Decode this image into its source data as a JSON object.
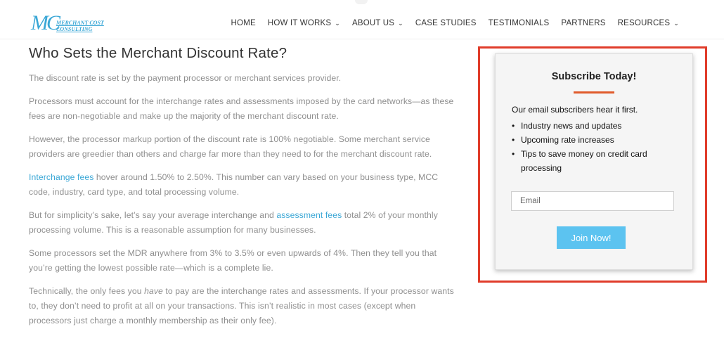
{
  "header": {
    "logo": {
      "mark": "MC",
      "text_line1": "MERCHANT COST",
      "text_line2": "CONSULTING"
    },
    "nav": [
      {
        "label": "HOME",
        "dropdown": false
      },
      {
        "label": "HOW IT WORKS",
        "dropdown": true
      },
      {
        "label": "ABOUT US",
        "dropdown": true
      },
      {
        "label": "CASE STUDIES",
        "dropdown": false
      },
      {
        "label": "TESTIMONIALS",
        "dropdown": false
      },
      {
        "label": "PARTNERS",
        "dropdown": false
      },
      {
        "label": "RESOURCES",
        "dropdown": true
      }
    ]
  },
  "article": {
    "title": "Who Sets the Merchant Discount Rate?",
    "p1": "The discount rate is set by the payment processor or merchant services provider.",
    "p2": "Processors must account for the interchange rates and assessments imposed by the card networks—as these fees are non-negotiable and make up the majority of the merchant discount rate.",
    "p3": "However, the processor markup portion of the discount rate is 100% negotiable. Some merchant service providers are greedier than others and charge far more than they need to for the merchant discount rate.",
    "p4_link": "Interchange fees",
    "p4_rest": " hover around 1.50% to 2.50%. This number can vary based on your business type, MCC code, industry, card type, and total processing volume.",
    "p5_before": "But for simplicity’s sake, let’s say your average interchange and ",
    "p5_link": "assessment fees",
    "p5_after": " total 2% of your monthly processing volume. This is a reasonable assumption for many businesses.",
    "p6": "Some processors set the MDR anywhere from 3% to 3.5% or even upwards of 4%. Then they tell you that you’re getting the lowest possible rate—which is a complete lie.",
    "p7_before": "Technically, the only fees you ",
    "p7_em": "have",
    "p7_after": " to pay are the interchange rates and assessments. If your processor wants to, they don’t need to profit at all on your transactions. This isn’t realistic in most cases (except when processors just charge a monthly membership as their only fee)."
  },
  "subscribe": {
    "title": "Subscribe Today!",
    "intro": "Our email subscribers hear it first.",
    "bullet": "•",
    "items": [
      "Industry news and updates",
      "Upcoming rate increases",
      "Tips to save money on credit card processing"
    ],
    "email_placeholder": "Email",
    "button_label": "Join Now!"
  },
  "colors": {
    "accent_link": "#3aa7d6",
    "highlight_border": "#e03c2a",
    "divider": "#e05b2c",
    "button": "#5cc3f0"
  }
}
